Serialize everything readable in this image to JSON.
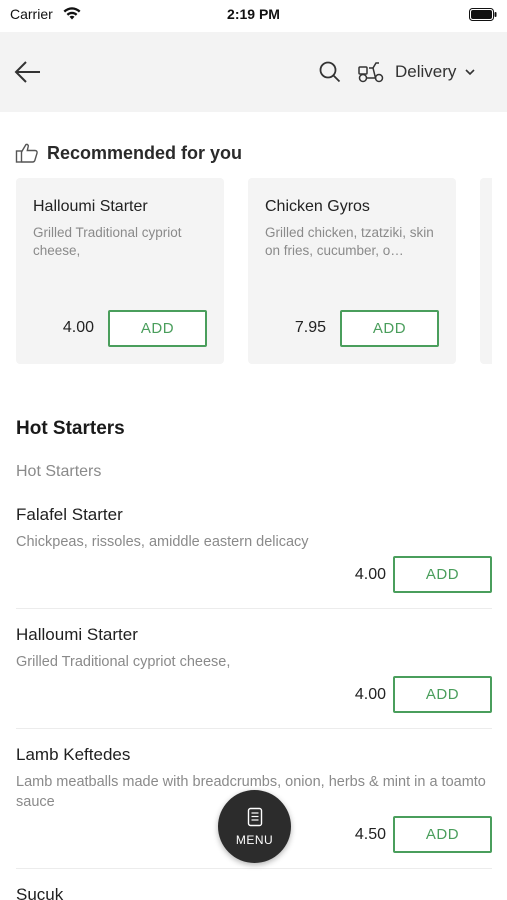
{
  "status_bar": {
    "carrier": "Carrier",
    "time": "2:19 PM"
  },
  "app_bar": {
    "delivery_label": "Delivery"
  },
  "recommended": {
    "title": "Recommended for you",
    "cards": [
      {
        "name": "Halloumi Starter",
        "description": "Grilled Traditional cypriot cheese,",
        "price": "4.00",
        "add_label": "ADD"
      },
      {
        "name": "Chicken Gyros",
        "description": "Grilled chicken, tzatziki, skin on fries, cucumber, o…",
        "price": "7.95",
        "add_label": "ADD"
      }
    ]
  },
  "section": {
    "title": "Hot Starters",
    "subtitle": "Hot Starters",
    "items": [
      {
        "name": "Falafel Starter",
        "description": "Chickpeas, rissoles, amiddle eastern delicacy",
        "price": "4.00",
        "add_label": "ADD"
      },
      {
        "name": "Halloumi Starter",
        "description": "Grilled Traditional cypriot cheese,",
        "price": "4.00",
        "add_label": "ADD"
      },
      {
        "name": "Lamb Keftedes",
        "description": "Lamb meatballs made with breadcrumbs, onion, herbs & mint in a toamto sauce",
        "price": "4.50",
        "add_label": "ADD"
      },
      {
        "name": "Sucuk"
      }
    ]
  },
  "menu_button": {
    "label": "MENU"
  },
  "colors": {
    "accent": "#4a9e5c",
    "header_bg": "#f3f3f3",
    "card_bg": "#f4f4f4",
    "fab_bg": "#2c2c2c"
  }
}
